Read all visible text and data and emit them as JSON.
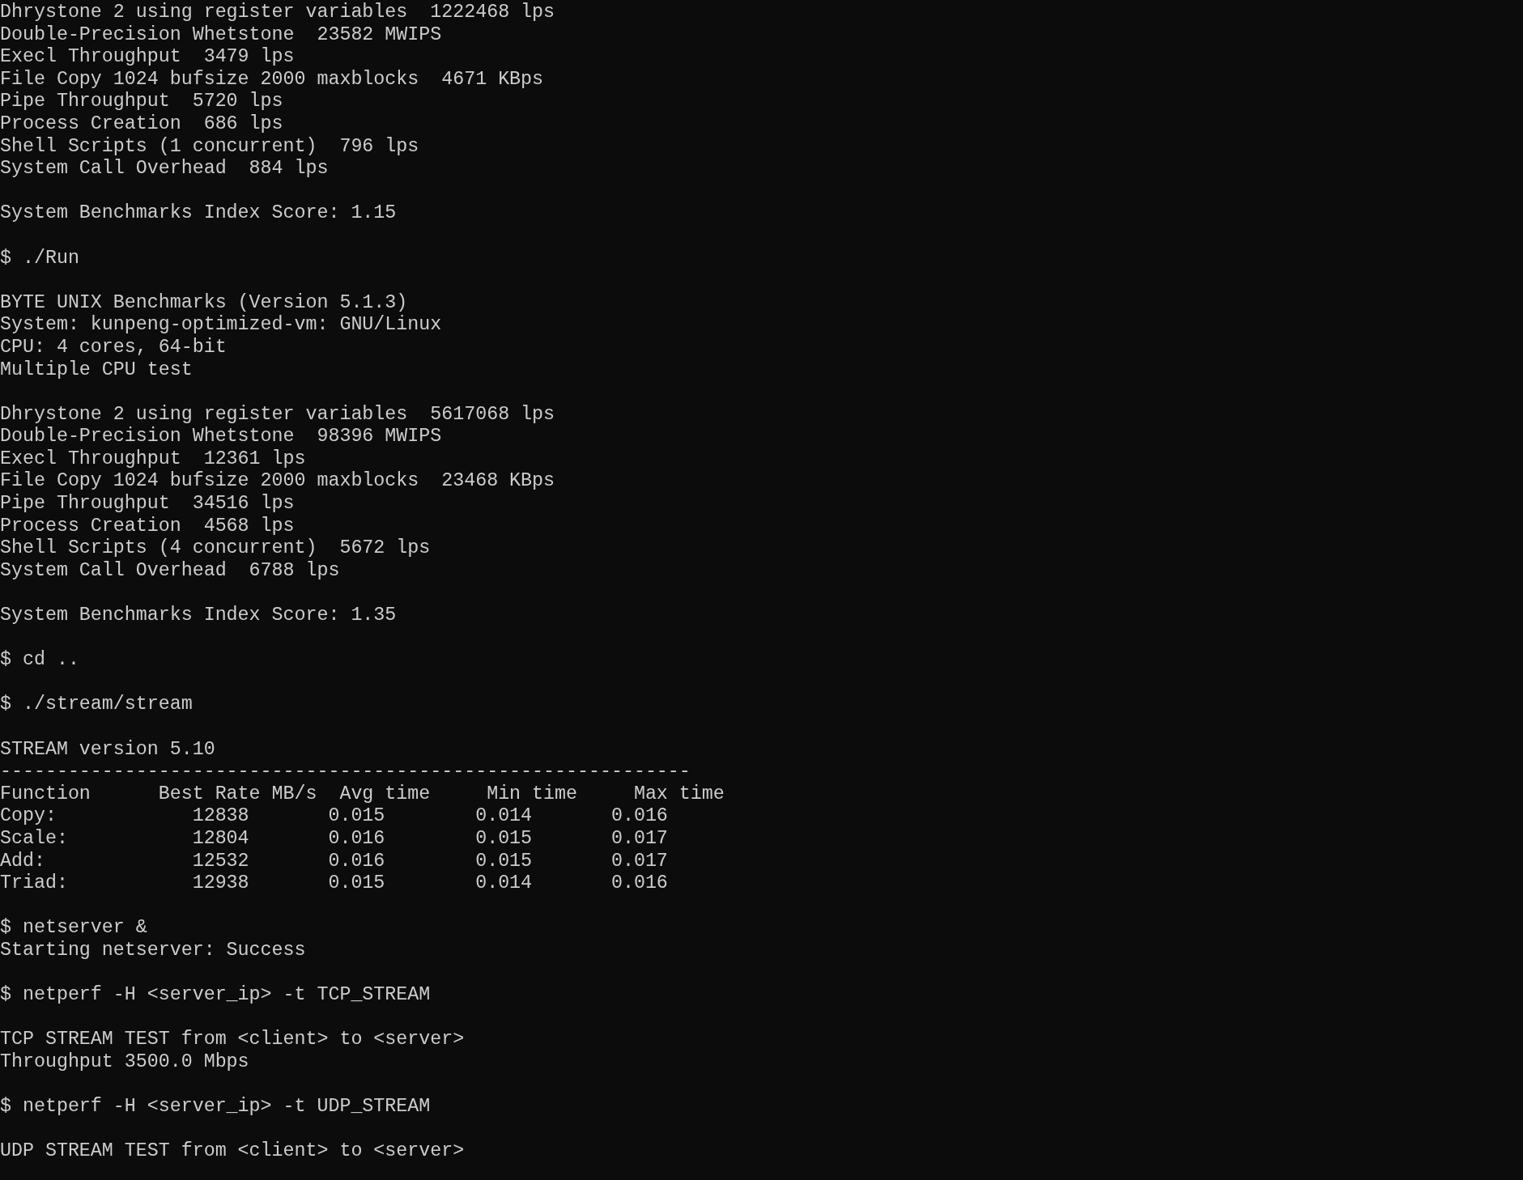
{
  "terminal": {
    "blocks": [
      {
        "lines": [
          "Dhrystone 2 using register variables  1222468 lps",
          "Double-Precision Whetstone  23582 MWIPS",
          "Execl Throughput  3479 lps",
          "File Copy 1024 bufsize 2000 maxblocks  4671 KBps",
          "Pipe Throughput  5720 lps",
          "Process Creation  686 lps",
          "Shell Scripts (1 concurrent)  796 lps",
          "System Call Overhead  884 lps"
        ]
      },
      {
        "lines": [
          "System Benchmarks Index Score: 1.15"
        ]
      },
      {
        "lines": [
          "$ ./Run"
        ]
      },
      {
        "lines": [
          "BYTE UNIX Benchmarks (Version 5.1.3)",
          "System: kunpeng-optimized-vm: GNU/Linux",
          "CPU: 4 cores, 64-bit",
          "Multiple CPU test"
        ]
      },
      {
        "lines": [
          "Dhrystone 2 using register variables  5617068 lps",
          "Double-Precision Whetstone  98396 MWIPS",
          "Execl Throughput  12361 lps",
          "File Copy 1024 bufsize 2000 maxblocks  23468 KBps",
          "Pipe Throughput  34516 lps",
          "Process Creation  4568 lps",
          "Shell Scripts (4 concurrent)  5672 lps",
          "System Call Overhead  6788 lps"
        ]
      },
      {
        "lines": [
          "System Benchmarks Index Score: 1.35"
        ]
      },
      {
        "lines": [
          "$ cd .."
        ]
      },
      {
        "lines": [
          "$ ./stream/stream"
        ]
      },
      {
        "lines": [
          "STREAM version 5.10",
          "-------------------------------------------------------------",
          "Function      Best Rate MB/s  Avg time     Min time     Max time",
          "Copy:            12838       0.015        0.014       0.016",
          "Scale:           12804       0.016        0.015       0.017",
          "Add:             12532       0.016        0.015       0.017",
          "Triad:           12938       0.015        0.014       0.016"
        ]
      },
      {
        "lines": [
          "$ netserver &",
          "Starting netserver: Success"
        ]
      },
      {
        "lines": [
          "$ netperf -H <server_ip> -t TCP_STREAM"
        ]
      },
      {
        "lines": [
          "TCP STREAM TEST from <client> to <server>",
          "Throughput 3500.0 Mbps"
        ]
      },
      {
        "lines": [
          "$ netperf -H <server_ip> -t UDP_STREAM"
        ]
      },
      {
        "lines": [
          "UDP STREAM TEST from <client> to <server>"
        ]
      }
    ]
  }
}
